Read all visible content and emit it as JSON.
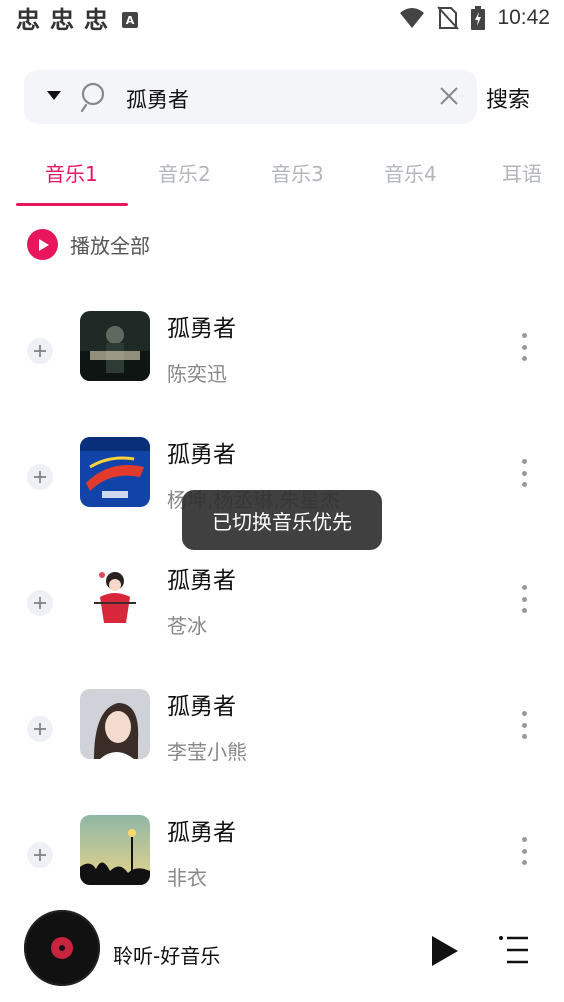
{
  "status_bar": {
    "app_icons": [
      "忠",
      "忠",
      "忠"
    ],
    "notification_icon": "A",
    "time": "10:42",
    "icons": [
      "wifi-icon",
      "no-sim-icon",
      "battery-charging-icon"
    ]
  },
  "search": {
    "query": "孤勇者",
    "button_label": "搜索",
    "icons": [
      "dropdown-caret-icon",
      "search-icon",
      "clear-icon"
    ]
  },
  "tabs": [
    {
      "label": "音乐1",
      "active": true
    },
    {
      "label": "音乐2",
      "active": false
    },
    {
      "label": "音乐3",
      "active": false
    },
    {
      "label": "音乐4",
      "active": false
    },
    {
      "label": "耳语",
      "active": false
    }
  ],
  "play_all": {
    "label": "播放全部",
    "icon": "play-circle-icon"
  },
  "songs": [
    {
      "title": "孤勇者",
      "artist": "陈奕迅"
    },
    {
      "title": "孤勇者",
      "artist": "杨坤,杨丞琳,朱星杰"
    },
    {
      "title": "孤勇者",
      "artist": "苍冰"
    },
    {
      "title": "孤勇者",
      "artist": "李莹小熊"
    },
    {
      "title": "孤勇者",
      "artist": "非衣"
    }
  ],
  "toast": {
    "text": "已切换音乐优先"
  },
  "player": {
    "title": "聆听-好音乐",
    "icons": [
      "disc-icon",
      "play-icon",
      "playlist-icon"
    ]
  },
  "colors": {
    "accent": "#e8175d",
    "inactive_tab": "#b3b6bd",
    "artist_text": "#888888"
  }
}
